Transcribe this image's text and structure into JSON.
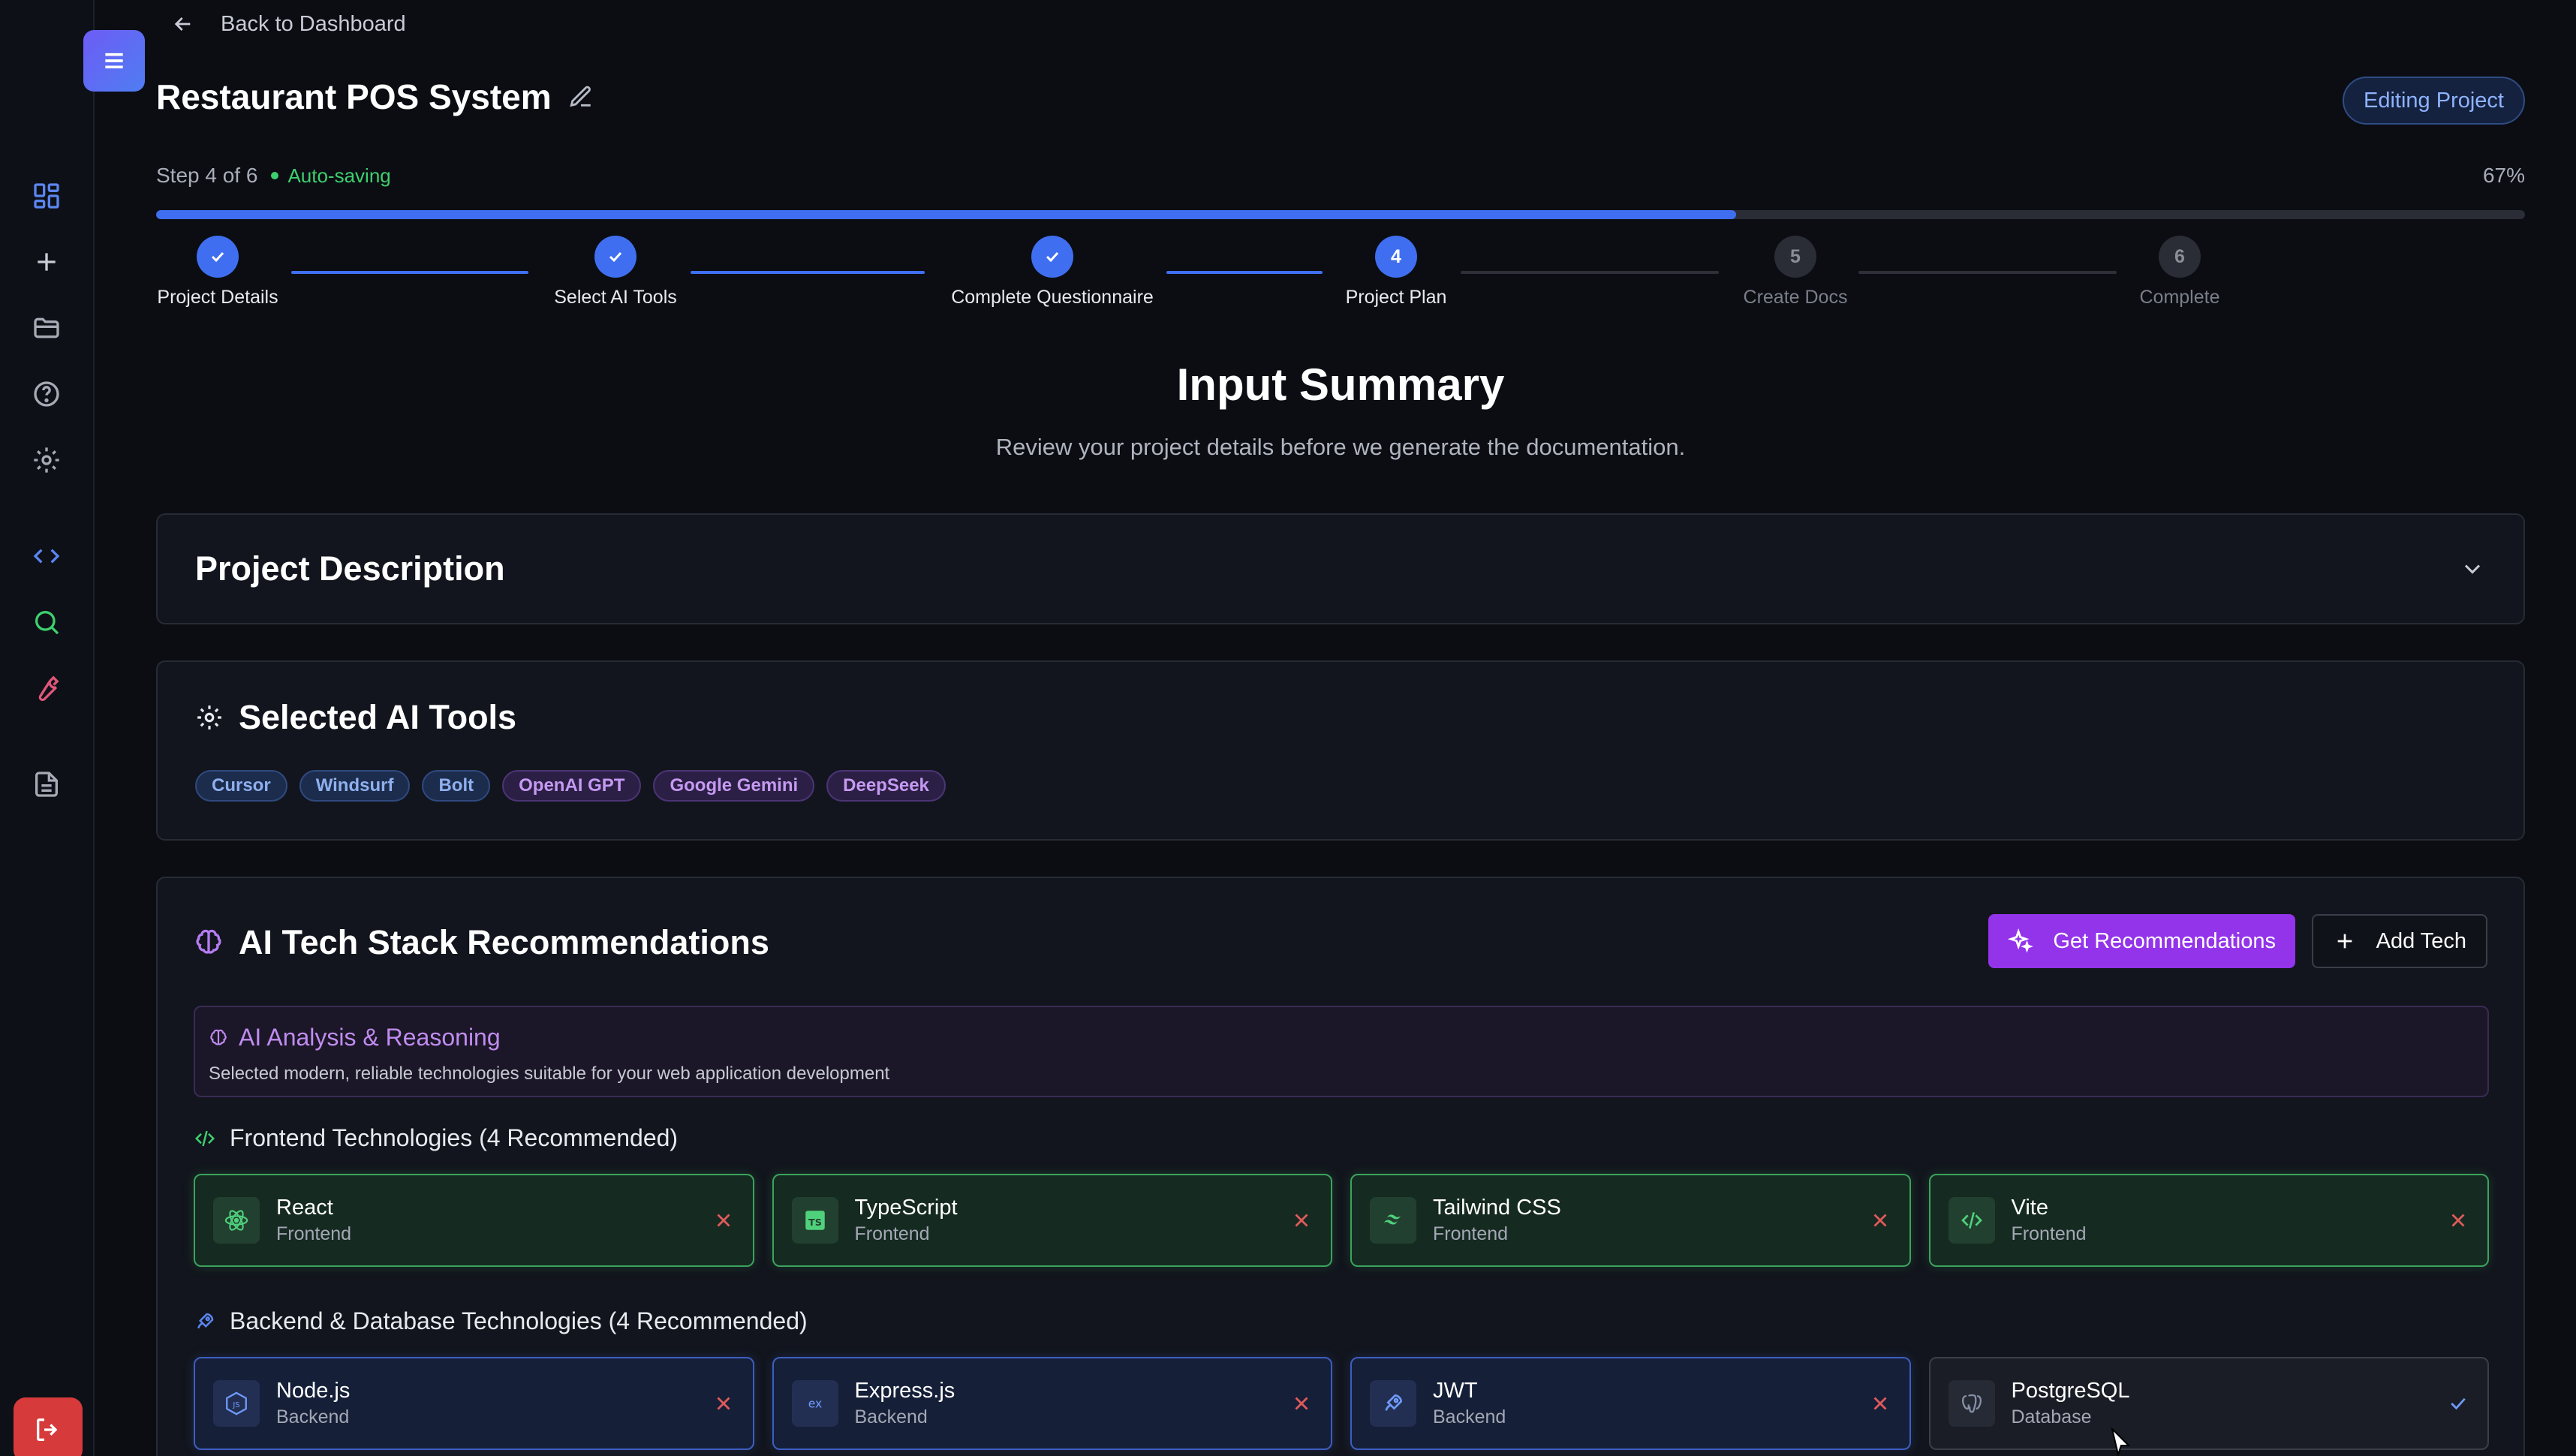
{
  "nav": {
    "back_label": "Back to Dashboard"
  },
  "project": {
    "title": "Restaurant POS System",
    "badge": "Editing Project"
  },
  "progress": {
    "step_text": "Step 4 of 6",
    "autosave": "Auto-saving",
    "percent_label": "67%",
    "fraction": 0.667
  },
  "steps": [
    {
      "number": "1",
      "label": "Project Details",
      "state": "done"
    },
    {
      "number": "2",
      "label": "Select AI Tools",
      "state": "done"
    },
    {
      "number": "3",
      "label": "Complete Questionnaire",
      "state": "done"
    },
    {
      "number": "4",
      "label": "Project Plan",
      "state": "active"
    },
    {
      "number": "5",
      "label": "Create Docs",
      "state": "pending"
    },
    {
      "number": "6",
      "label": "Complete",
      "state": "pending"
    }
  ],
  "summary": {
    "title": "Input Summary",
    "subtitle": "Review your project details before we generate the documentation."
  },
  "project_description": {
    "title": "Project Description"
  },
  "ai_tools": {
    "title": "Selected AI Tools",
    "tags": [
      {
        "label": "Cursor",
        "color": "blue"
      },
      {
        "label": "Windsurf",
        "color": "blue"
      },
      {
        "label": "Bolt",
        "color": "blue"
      },
      {
        "label": "OpenAI GPT",
        "color": "purple"
      },
      {
        "label": "Google Gemini",
        "color": "purple"
      },
      {
        "label": "DeepSeek",
        "color": "purple"
      }
    ]
  },
  "tech_stack": {
    "title": "AI Tech Stack Recommendations",
    "get_recommendations_label": "Get Recommendations",
    "add_tech_label": "Add Tech",
    "analysis_title": "AI Analysis & Reasoning",
    "analysis_text": "Selected modern, reliable technologies suitable for your web application development",
    "frontend": {
      "heading": "Frontend Technologies (4 Recommended)",
      "items": [
        {
          "name": "React",
          "category": "Frontend",
          "icon": "react-icon",
          "action": "remove"
        },
        {
          "name": "TypeScript",
          "category": "Frontend",
          "icon": "typescript-icon",
          "action": "remove"
        },
        {
          "name": "Tailwind CSS",
          "category": "Frontend",
          "icon": "tailwind-icon",
          "action": "remove"
        },
        {
          "name": "Vite",
          "category": "Frontend",
          "icon": "code-icon",
          "action": "remove"
        }
      ]
    },
    "backend": {
      "heading": "Backend & Database Technologies (4 Recommended)",
      "items": [
        {
          "name": "Node.js",
          "category": "Backend",
          "icon": "nodejs-icon",
          "action": "remove"
        },
        {
          "name": "Express.js",
          "category": "Backend",
          "icon": "express-icon",
          "action": "remove"
        },
        {
          "name": "JWT",
          "category": "Backend",
          "icon": "rocket-icon",
          "action": "remove"
        },
        {
          "name": "PostgreSQL",
          "category": "Database",
          "icon": "postgresql-icon",
          "action": "add"
        }
      ]
    }
  },
  "colors": {
    "accent_blue": "#3f6ff0",
    "accent_purple": "#9333ea",
    "success_green": "#3ecf6e",
    "danger_red": "#e05a5a"
  }
}
